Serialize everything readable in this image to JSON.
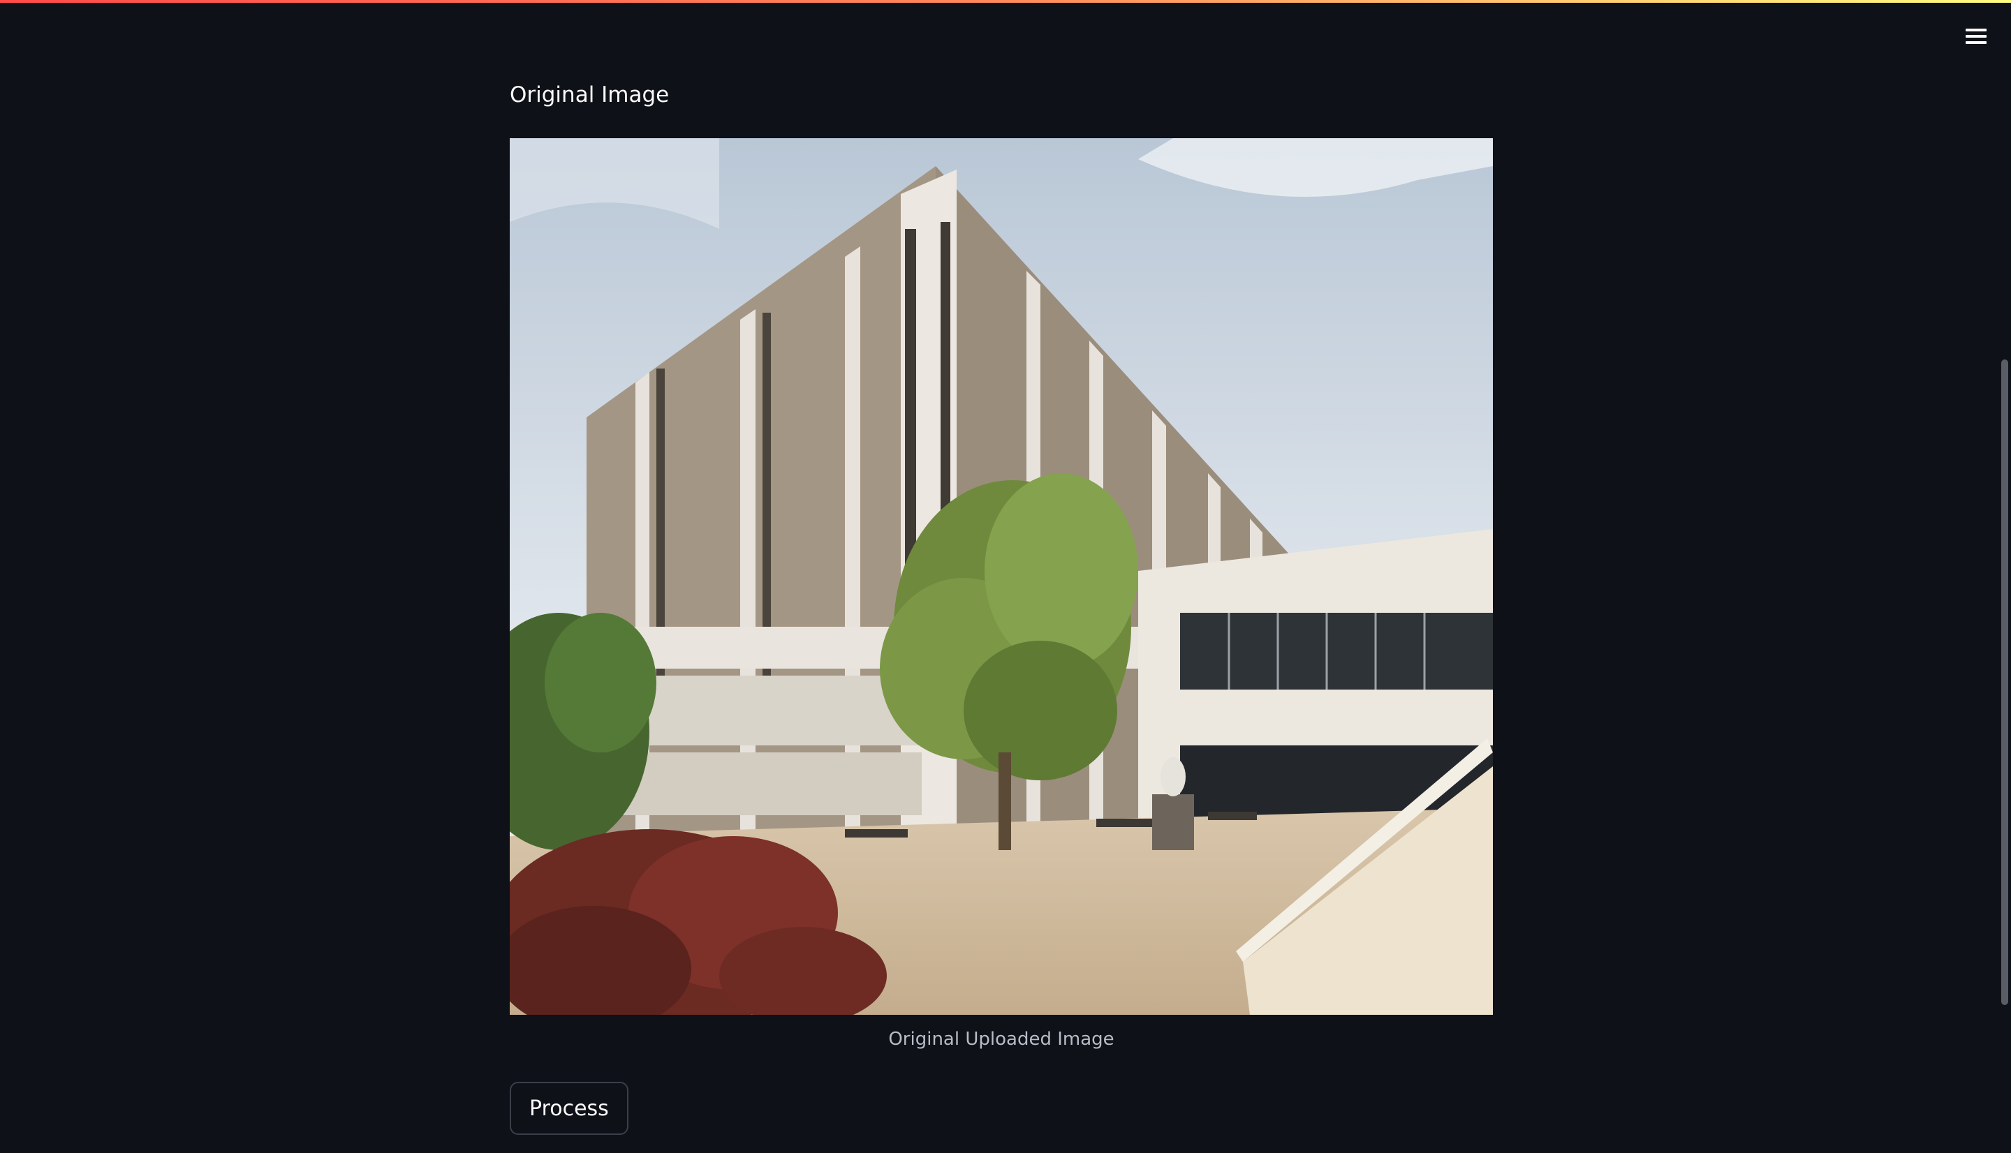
{
  "header": {
    "menu_icon": "hamburger-menu-icon"
  },
  "main": {
    "section_title": "Original Image",
    "image": {
      "description_icon": "uploaded-photo-building",
      "caption": "Original Uploaded Image"
    },
    "process_button_label": "Process"
  },
  "colors": {
    "background": "#0e1117",
    "text": "#fafafa",
    "caption_text": "#b7bcc6",
    "button_border": "#3b3f4a",
    "accent_gradient_start": "#ff4b4b",
    "accent_gradient_end": "#fffd80"
  }
}
